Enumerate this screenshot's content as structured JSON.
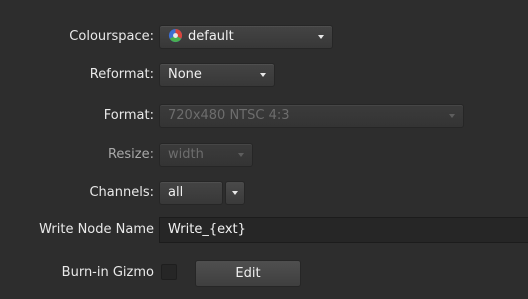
{
  "colourspace": {
    "label": "Colourspace:",
    "value": "default",
    "icon": "colour-wheel-icon"
  },
  "reformat": {
    "label": "Reformat:",
    "value": "None"
  },
  "format": {
    "label": "Format:",
    "value": "720x480 NTSC 4:3",
    "enabled": false
  },
  "resize": {
    "label": "Resize:",
    "value": "width",
    "enabled": false
  },
  "channels": {
    "label": "Channels:",
    "value": "all"
  },
  "write_node_name": {
    "label": "Write Node Name",
    "value": "Write_{ext}"
  },
  "burn_in_gizmo": {
    "label": "Burn-in Gizmo",
    "checked": false,
    "edit_label": "Edit"
  },
  "colors": {
    "background": "#2d2d2d",
    "control": "#3e3e3e",
    "field": "#262626",
    "text": "#e6e6e6",
    "disabled_text": "#6d6d6d"
  }
}
